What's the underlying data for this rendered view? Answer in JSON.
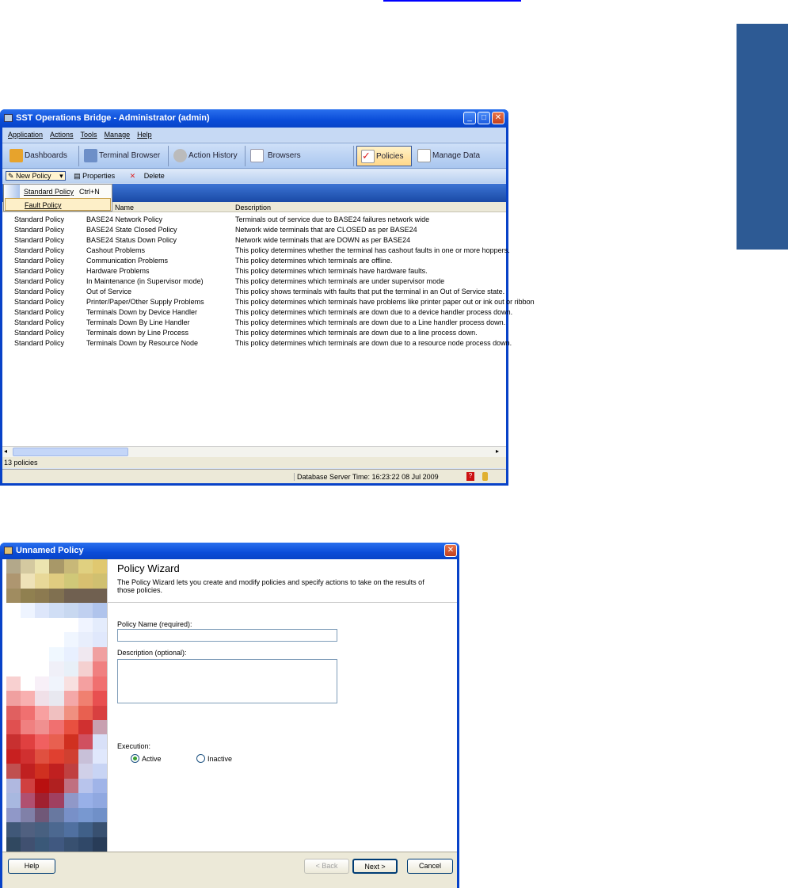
{
  "main_window": {
    "title": "SST Operations Bridge - Administrator (admin)",
    "menu": [
      "Application",
      "Actions",
      "Tools",
      "Manage",
      "Help"
    ],
    "nav": [
      "Dashboards",
      "Terminal Browser",
      "Action History",
      "Browsers",
      "Policies",
      "Manage Data"
    ],
    "active_nav": "Policies",
    "toolbar": {
      "new_policy": "New Policy",
      "properties": "Properties",
      "delete": "Delete"
    },
    "dropdown": [
      {
        "label": "Standard Policy",
        "shortcut": "Ctrl+N"
      },
      {
        "label": "Fault Policy",
        "shortcut": ""
      }
    ],
    "columns": {
      "type": "",
      "name": "Name",
      "description": "Description"
    },
    "rows": [
      [
        "Standard Policy",
        "BASE24 Network Policy",
        "Terminals out of service due to BASE24 failures network wide"
      ],
      [
        "Standard Policy",
        "BASE24 State Closed Policy",
        "Network wide terminals that are CLOSED as per BASE24"
      ],
      [
        "Standard Policy",
        "BASE24 Status Down Policy",
        "Network wide terminals that are DOWN as per BASE24"
      ],
      [
        "Standard Policy",
        "Cashout Problems",
        "This policy determines whether the terminal has cashout faults in one or more hoppers."
      ],
      [
        "Standard Policy",
        "Communication Problems",
        "This policy determines which terminals are offline."
      ],
      [
        "Standard Policy",
        "Hardware Problems",
        "This policy determines which terminals have hardware faults."
      ],
      [
        "Standard Policy",
        "In Maintenance (in Supervisor mode)",
        "This policy determines which terminals are under supervisor mode"
      ],
      [
        "Standard Policy",
        "Out of Service",
        "This policy shows terminals with faults that put the terminal in an Out of Service state."
      ],
      [
        "Standard Policy",
        "Printer/Paper/Other Supply Problems",
        "This policy determines which terminals have problems like printer paper out or ink out or ribbon"
      ],
      [
        "Standard Policy",
        "Terminals Down by Device Handler",
        "This policy determines which terminals are down due to a device handler process down."
      ],
      [
        "Standard Policy",
        "Terminals Down By Line Handler",
        "This policy determines which terminals are down due to a Line handler process down."
      ],
      [
        "Standard Policy",
        "Terminals down by Line Process",
        "This policy determines which terminals are down due to a line process down."
      ],
      [
        "Standard Policy",
        "Terminals Down by Resource Node",
        "This policy determines which terminals are down due to a resource node process down."
      ]
    ],
    "count_text": "13 policies",
    "server_time": "Database Server Time: 16:23:22 08 Jul 2009"
  },
  "wizard": {
    "title": "Unnamed Policy",
    "heading": "Policy Wizard",
    "intro": "The Policy Wizard lets you create and modify policies and specify actions to take on the results of those policies.",
    "name_label": "Policy Name (required):",
    "name_value": "",
    "desc_label": "Description (optional):",
    "desc_value": "",
    "execution_label": "Execution:",
    "options": [
      "Active",
      "Inactive"
    ],
    "selected": "Active",
    "buttons": {
      "help": "Help",
      "back": "< Back",
      "next": "Next >",
      "cancel": "Cancel"
    }
  }
}
